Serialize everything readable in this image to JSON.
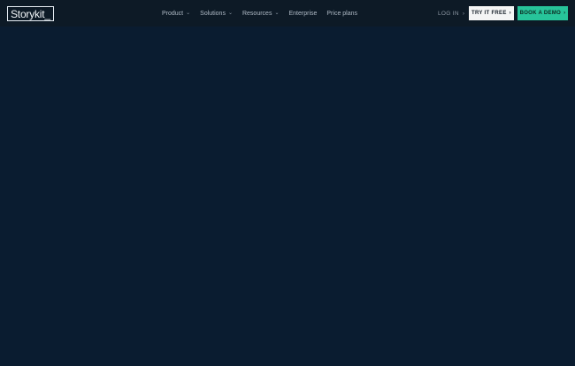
{
  "brand": {
    "logo_text": "Storykit_"
  },
  "nav": {
    "items": [
      {
        "label": "Product",
        "has_dropdown": true
      },
      {
        "label": "Solutions",
        "has_dropdown": true
      },
      {
        "label": "Resources",
        "has_dropdown": true
      },
      {
        "label": "Enterprise",
        "has_dropdown": false
      },
      {
        "label": "Price plans",
        "has_dropdown": false
      }
    ]
  },
  "auth": {
    "login_label": "LOG IN",
    "trial_label": "TRY IT FREE",
    "demo_label": "BOOK A DEMO"
  },
  "colors": {
    "background": "#0a1c30",
    "navbar": "#0d1a26",
    "trial_button": "#f4f5f5",
    "demo_button": "#27c49a"
  },
  "icons": {
    "dropdown": "chevron-down-icon",
    "arrow": "arrow-right-icon"
  }
}
